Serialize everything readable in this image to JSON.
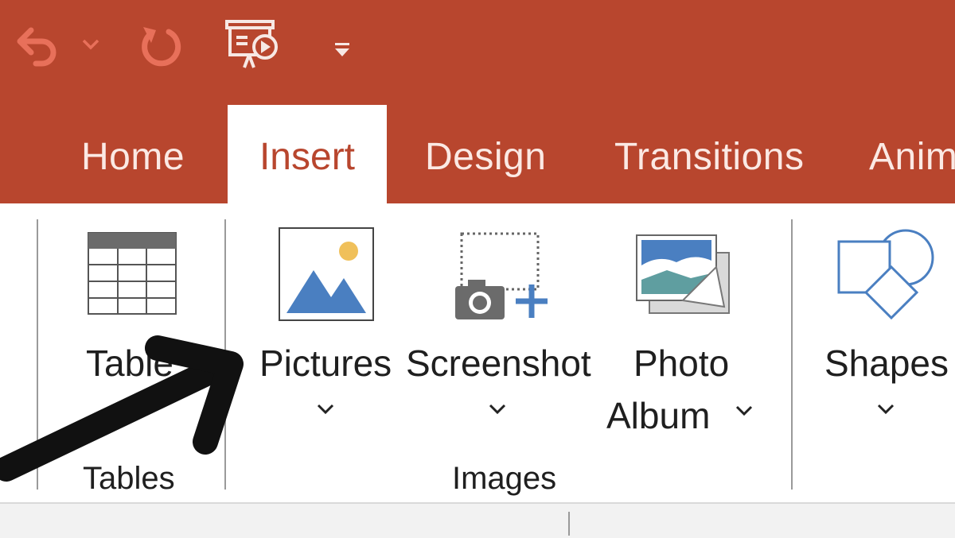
{
  "quick_access": {
    "icons": [
      "undo-icon",
      "chevron-down-icon",
      "redo-icon",
      "from-beginning-icon",
      "customize-qat-icon"
    ]
  },
  "tabs": [
    {
      "label": "Home",
      "active": false
    },
    {
      "label": "Insert",
      "active": true
    },
    {
      "label": "Design",
      "active": false
    },
    {
      "label": "Transitions",
      "active": false
    },
    {
      "label": "Anim",
      "active": false
    }
  ],
  "ribbon": {
    "tables_group": {
      "label": "Tables",
      "table_button": "Table"
    },
    "images_group": {
      "label": "Images",
      "pictures": "Pictures",
      "screenshot": "Screenshot",
      "photo_album_line1": "Photo",
      "photo_album_line2": "Album"
    },
    "shapes": "Shapes"
  },
  "colors": {
    "title_bar": "#b8462e",
    "active_tab_text": "#b8462e",
    "inactive_tab_text": "#fbe9e4",
    "icon_blue": "#4a7fc1",
    "icon_yellow": "#f0c05a",
    "arrow": "#111111"
  }
}
